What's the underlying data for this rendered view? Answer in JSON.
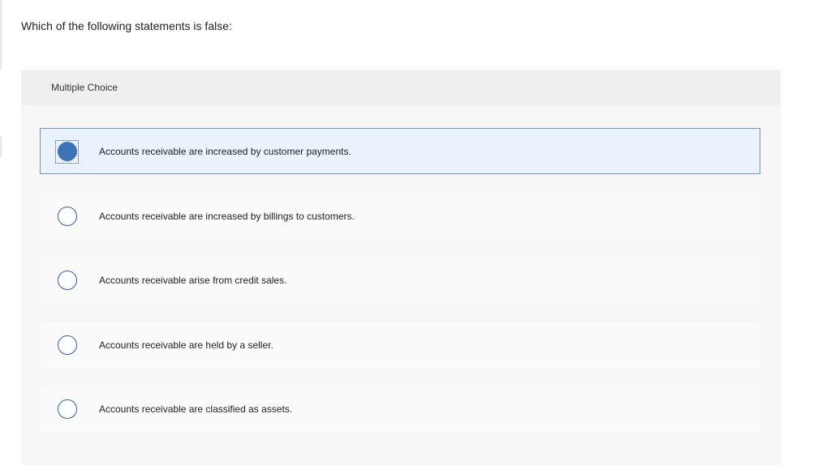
{
  "question": {
    "text": "Which of the following statements is false:"
  },
  "panel": {
    "header_label": "Multiple Choice"
  },
  "options": [
    {
      "label": "Accounts receivable are increased by customer payments.",
      "selected": true
    },
    {
      "label": "Accounts receivable are increased by billings to customers.",
      "selected": false
    },
    {
      "label": "Accounts receivable arise from credit sales.",
      "selected": false
    },
    {
      "label": "Accounts receivable are held by a seller.",
      "selected": false
    },
    {
      "label": "Accounts receivable are classified as assets.",
      "selected": false
    }
  ],
  "colors": {
    "selected_background": "#eaf2fb",
    "selected_border": "#6d93c0",
    "radio_fill": "#3f73b8",
    "radio_border": "#2f5f9e",
    "panel_background": "#f7f7f7",
    "header_background": "#efefef"
  }
}
